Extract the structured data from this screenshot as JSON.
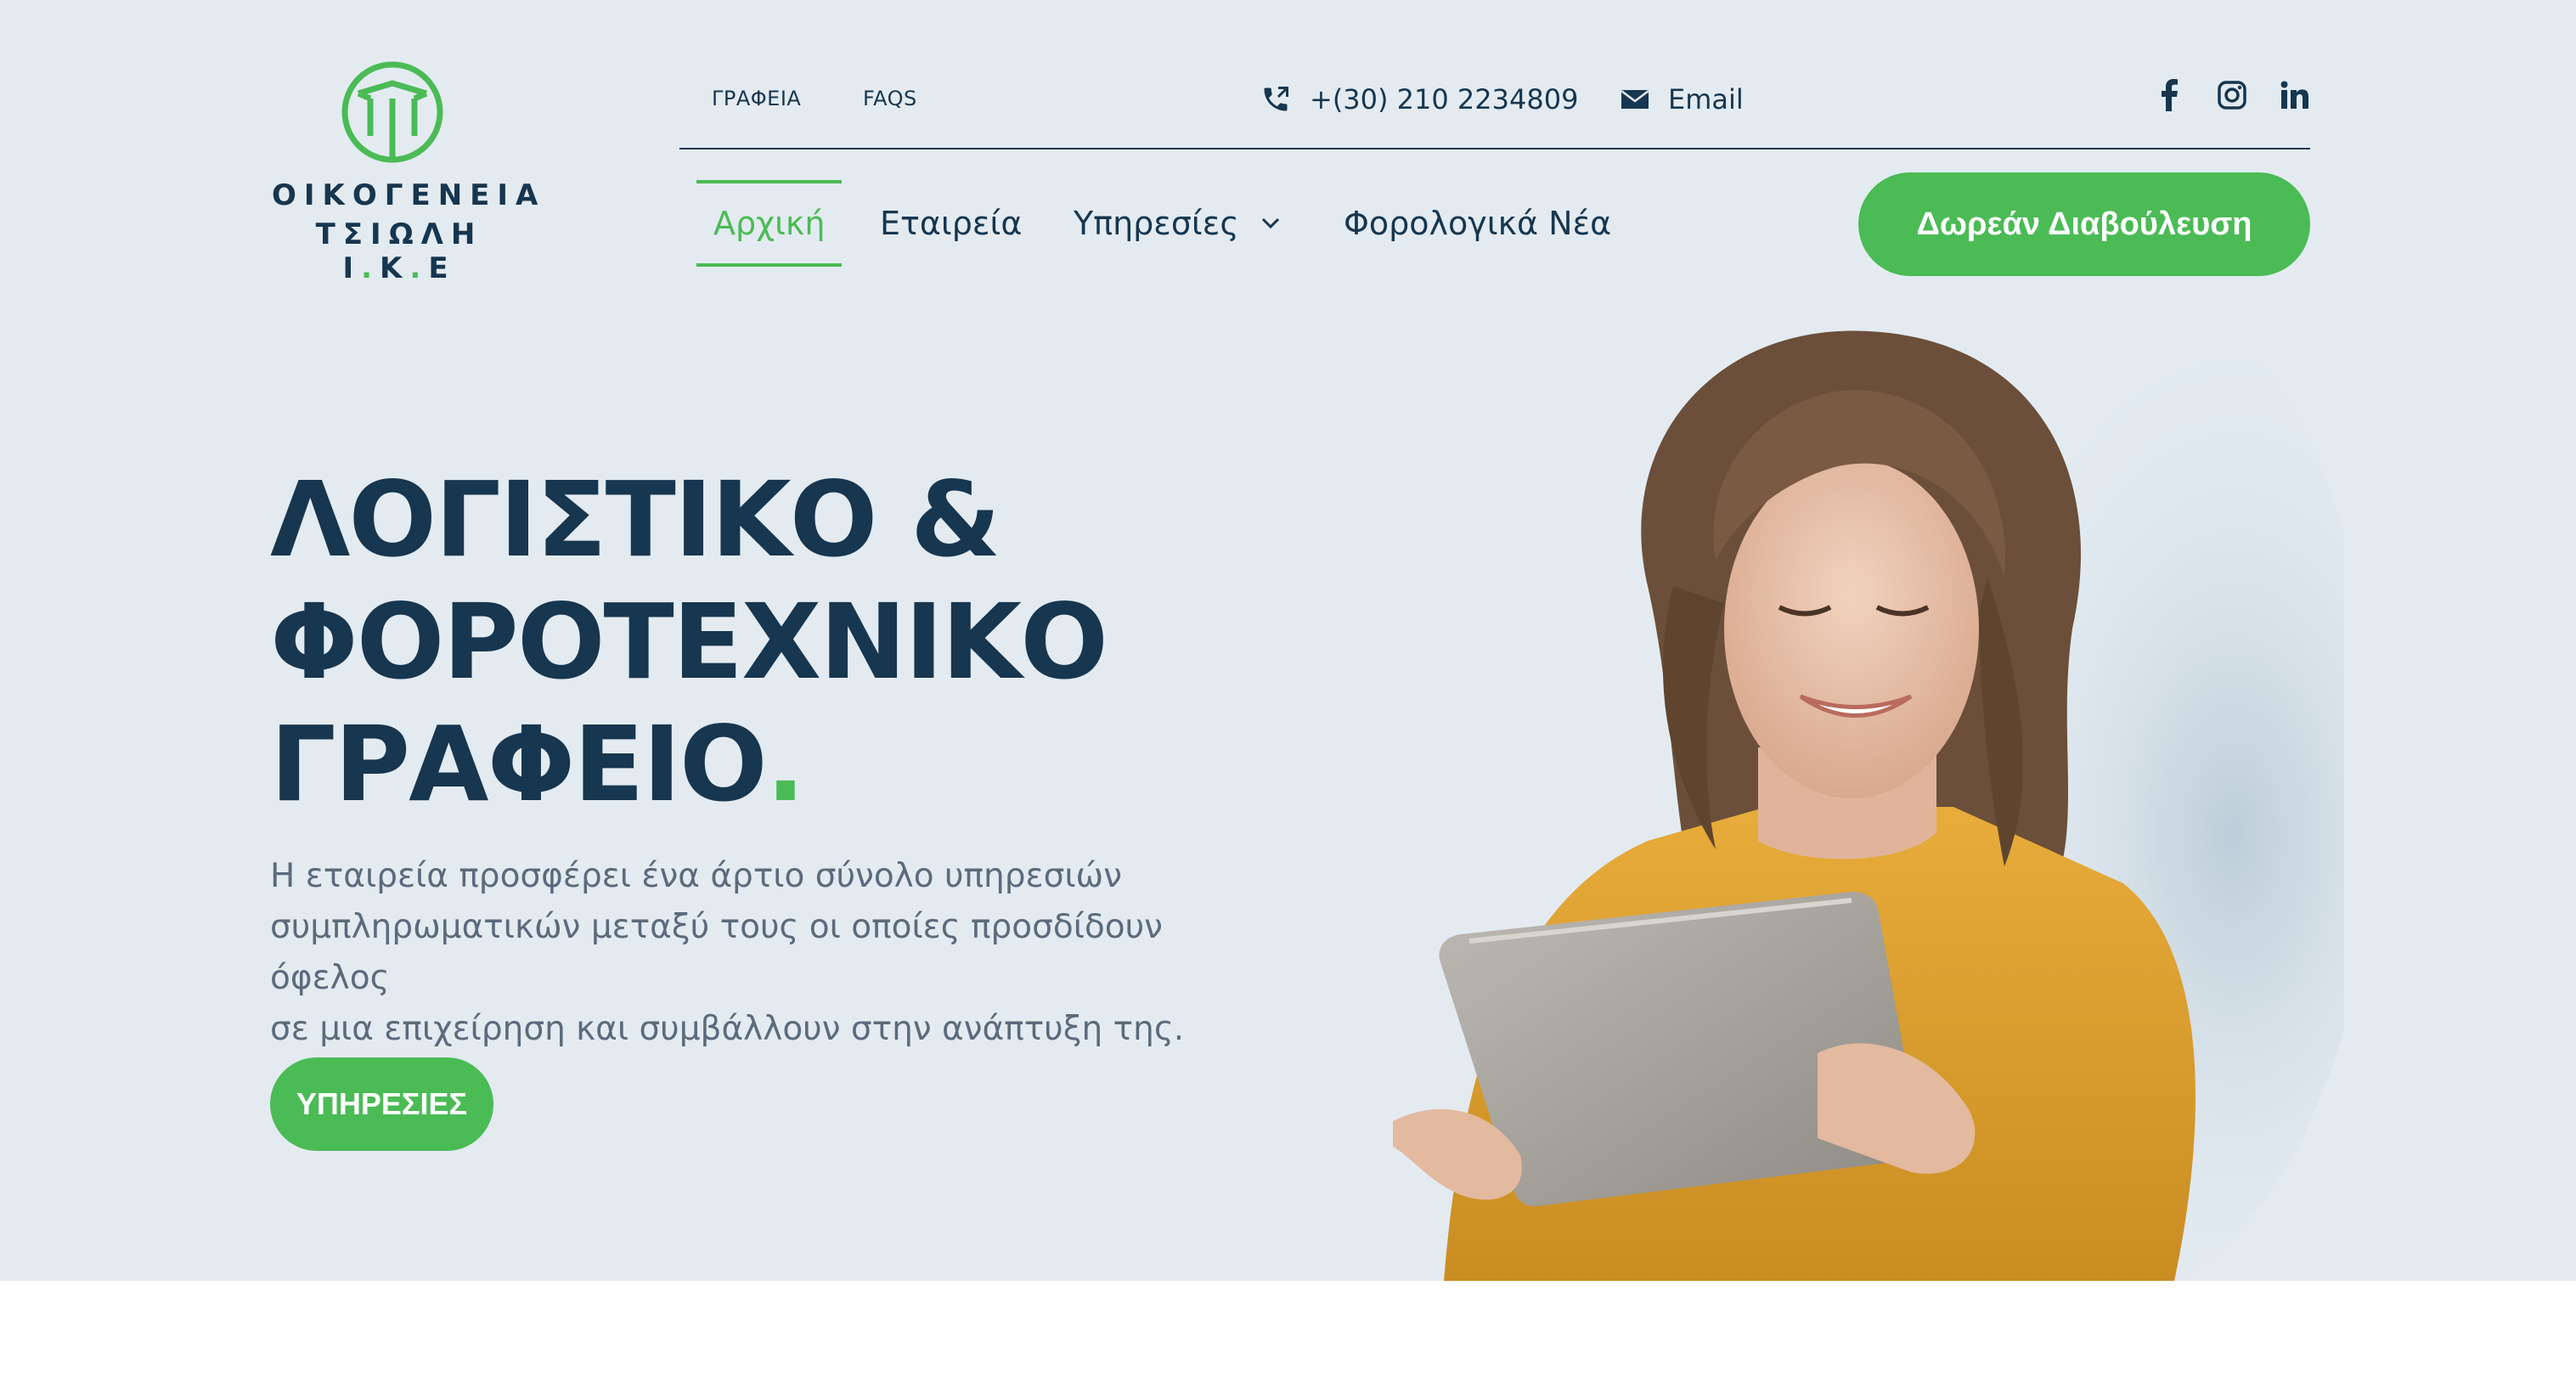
{
  "brand": {
    "line1": "ΟΙΚΟΓΕΝΕΙΑ",
    "line2_a": "ΤΣΙΩΛΗ Ι",
    "line2_dot1": ".",
    "line2_b": "Κ",
    "line2_dot2": ".",
    "line2_c": "Ε",
    "logo_icon": "tsioli-logo-icon",
    "accent_color": "#4bbb55",
    "text_color": "#17364f"
  },
  "topbar": {
    "links": [
      "ΓΡΑΦΕΙΑ",
      "FAQS"
    ],
    "phone": "+(30) 210 2234809",
    "phone_icon": "phone-icon",
    "email": "Email",
    "email_icon": "envelope-icon",
    "social": [
      "facebook-icon",
      "instagram-icon",
      "linkedin-icon"
    ]
  },
  "nav": {
    "items": [
      {
        "label": "Αρχική"
      },
      {
        "label": "Εταιρεία"
      },
      {
        "label": "Υπηρεσίες"
      },
      {
        "label": "Φορολογικά Νέα"
      }
    ],
    "active_index": 0,
    "cta": "Δωρεάν Διαβούλευση"
  },
  "hero": {
    "title_line1": "ΛΟΓΙΣΤΙΚΟ &",
    "title_line2": "ΦΟΡΟΤΕΧΝΙΚΟ",
    "title_line3": "ΓΡΑΦΕΙΟ",
    "title_dot": ".",
    "description_line1": "Η εταιρεία προσφέρει ένα άρτιο σύνολο υπηρεσιών",
    "description_line2": "συμπληρωματικών μεταξύ τους οι οποίες προσδίδουν όφελος",
    "description_line3": "σε μια επιχείρηση και συμβάλλουν στην ανάπτυξη της.",
    "button": "ΥΠΗΡΕΣΙΕΣ",
    "background_color": "#e3ebf1"
  }
}
